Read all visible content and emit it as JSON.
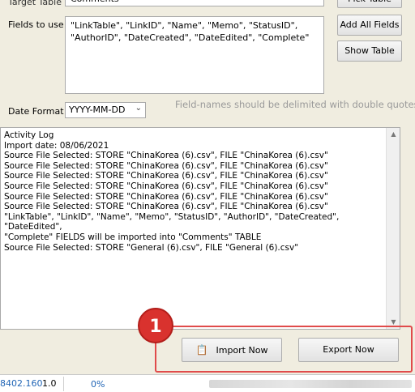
{
  "form": {
    "target_table_label": "Target Table",
    "target_table_value": "Comments",
    "pick_table_label": "Pick Table",
    "fields_label": "Fields to use",
    "fields_value": "\"LinkTable\", \"LinkID\", \"Name\", \"Memo\", \"StatusID\", \"AuthorID\", \"DateCreated\", \"DateEdited\", \"Complete\"",
    "add_all_fields_label": "Add All Fields",
    "show_table_label": "Show Table",
    "date_format_label": "Date Format",
    "date_format_value": "YYYY-MM-DD",
    "hint": "Field-names should be delimited with double quotes."
  },
  "log": {
    "lines": [
      "Activity Log",
      "Import date: 08/06/2021",
      "Source File Selected: STORE \"ChinaKorea (6).csv\", FILE \"ChinaKorea (6).csv\"",
      "Source File Selected: STORE \"ChinaKorea (6).csv\", FILE \"ChinaKorea (6).csv\"",
      "Source File Selected: STORE \"ChinaKorea (6).csv\", FILE \"ChinaKorea (6).csv\"",
      "Source File Selected: STORE \"ChinaKorea (6).csv\", FILE \"ChinaKorea (6).csv\"",
      "Source File Selected: STORE \"ChinaKorea (6).csv\", FILE \"ChinaKorea (6).csv\"",
      "Source File Selected: STORE \"ChinaKorea (6).csv\", FILE \"ChinaKorea (6).csv\"",
      "\"LinkTable\", \"LinkID\", \"Name\", \"Memo\", \"StatusID\", \"AuthorID\", \"DateCreated\", \"DateEdited\",",
      "\"Complete\" FIELDS will be imported into \"Comments\" TABLE",
      "Source File Selected: STORE \"General (6).csv\", FILE \"General (6).csv\""
    ]
  },
  "actions": {
    "import_label": "Import Now",
    "export_label": "Export Now",
    "callout_number": "1"
  },
  "status": {
    "coord": "8402.160",
    "version": "1.0",
    "percent": "0%"
  },
  "colors": {
    "callout": "#d9322e",
    "highlight": "#e04b4b",
    "hint_text": "#9a9a9a"
  }
}
